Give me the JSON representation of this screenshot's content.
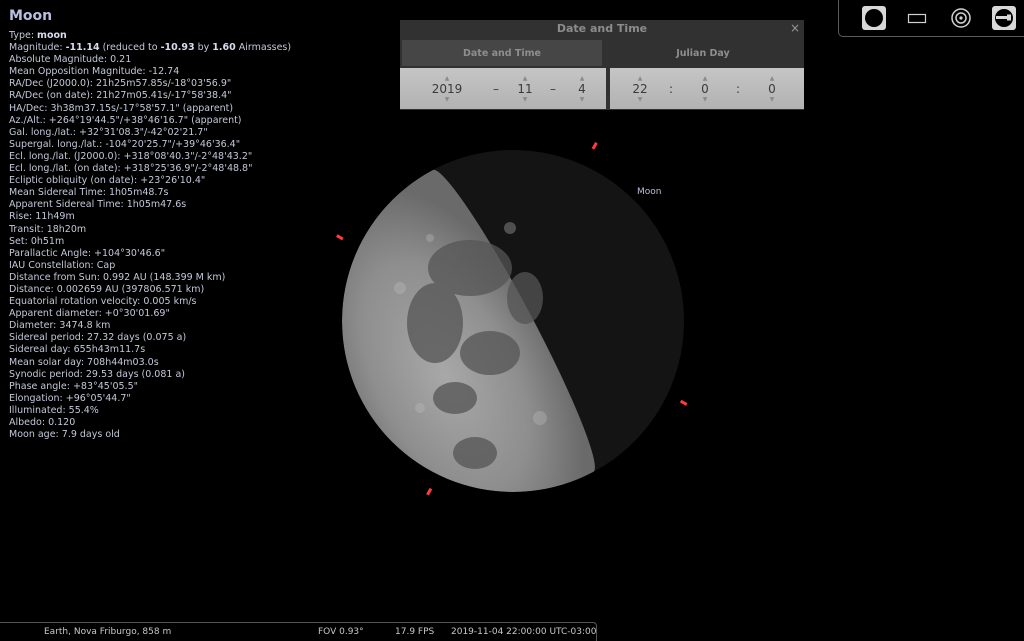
{
  "object": {
    "title": "Moon",
    "type_label": "Type: ",
    "type_value": "moon",
    "magnitude": {
      "label": "Magnitude: ",
      "value": "-11.14",
      "mid": " (reduced to ",
      "reduced": "-10.93",
      "by": " by ",
      "airmass": "1.60",
      "suffix": " Airmasses)"
    },
    "lines": [
      "Absolute Magnitude: 0.21",
      "Mean Opposition Magnitude: -12.74",
      "RA/Dec (J2000.0): 21h25m57.85s/-18°03'56.9\"",
      "RA/Dec (on date): 21h27m05.41s/-17°58'38.4\"",
      "HA/Dec: 3h38m37.15s/-17°58'57.1\" (apparent)",
      "Az./Alt.: +264°19'44.5\"/+38°46'16.7\" (apparent)",
      "Gal. long./lat.: +32°31'08.3\"/-42°02'21.7\"",
      "Supergal. long./lat.: -104°20'25.7\"/+39°46'36.4\"",
      "Ecl. long./lat. (J2000.0): +318°08'40.3\"/-2°48'43.2\"",
      "Ecl. long./lat. (on date): +318°25'36.9\"/-2°48'48.8\"",
      "Ecliptic obliquity (on date): +23°26'10.4\"",
      "Mean Sidereal Time: 1h05m48.7s",
      "Apparent Sidereal Time: 1h05m47.6s",
      "Rise: 11h49m",
      "Transit: 18h20m",
      "Set: 0h51m",
      "Parallactic Angle: +104°30'46.6\"",
      "IAU Constellation: Cap",
      "Distance from Sun: 0.992 AU (148.399 M km)",
      "Distance: 0.002659 AU (397806.571 km)",
      "Equatorial rotation velocity: 0.005 km/s",
      "Apparent diameter: +0°30'01.69\"",
      "Diameter: 3474.8 km",
      "Sidereal period: 27.32 days (0.075 a)",
      "Sidereal day: 655h43m11.7s",
      "Mean solar day: 708h44m03.0s",
      "Synodic period: 29.53 days (0.081 a)",
      "Phase angle: +83°45'05.5\"",
      "Elongation: +96°05'44.7\"",
      "Illuminated: 55.4%",
      "Albedo: 0.120",
      "Moon age: 7.9 days old"
    ],
    "sky_label": "Moon",
    "illuminated_fraction": 0.554
  },
  "datetime_window": {
    "title": "Date and Time",
    "close_glyph": "×",
    "tabs": [
      "Date and Time",
      "Julian Day"
    ],
    "active_tab": 0,
    "year": "2019",
    "month": "11",
    "day": "4",
    "hour": "22",
    "minute": "0",
    "second": "0",
    "date_sep": "–",
    "time_sep": ":",
    "arrow_up": "▲",
    "arrow_down": "▼"
  },
  "toolbar": {
    "icons": [
      "moon-icon",
      "rectangle-icon",
      "target-icon",
      "telescope-icon"
    ]
  },
  "statusbar": {
    "location": "Earth, Nova Friburgo, 858 m",
    "fov": "FOV 0.93°",
    "fps": "17.9 FPS",
    "datetime": "2019-11-04 22:00:00 UTC-03:00"
  },
  "colors": {
    "background": "#000000",
    "label": "#b7bfe2",
    "marker": "#ff3b3b"
  }
}
